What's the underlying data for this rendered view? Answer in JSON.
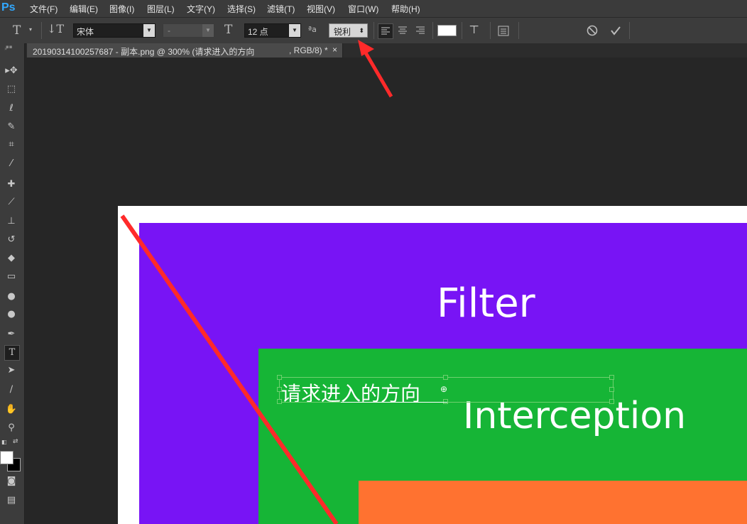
{
  "app": {
    "logo": "Ps"
  },
  "menu": [
    {
      "label": "文件(F)"
    },
    {
      "label": "编辑(E)"
    },
    {
      "label": "图像(I)"
    },
    {
      "label": "图层(L)"
    },
    {
      "label": "文字(Y)"
    },
    {
      "label": "选择(S)"
    },
    {
      "label": "滤镜(T)"
    },
    {
      "label": "视图(V)"
    },
    {
      "label": "窗口(W)"
    },
    {
      "label": "帮助(H)"
    }
  ],
  "options": {
    "font_family": "宋体",
    "font_style": "-",
    "font_size": "12 点",
    "antialias": "锐利",
    "antialias_prefix": "ªa",
    "text_color": "#ffffff"
  },
  "document_tab": {
    "title": "20190314100257687 - 副本.png @ 300% (请求进入的方向",
    "mode": ", RGB/8) *",
    "close": "×"
  },
  "canvas": {
    "filter_text": "Filter",
    "interception_text": "Interception",
    "editing_text": "请求进入的方向",
    "colors": {
      "purple": "#7814f5",
      "green": "#16b536",
      "orange": "#ff7230",
      "annotation": "#ff2a2a"
    }
  },
  "tools": [
    {
      "icon": "move-icon"
    },
    {
      "icon": "marquee-icon"
    },
    {
      "icon": "lasso-icon"
    },
    {
      "icon": "quick-select-icon"
    },
    {
      "icon": "crop-icon"
    },
    {
      "icon": "eyedropper-icon"
    },
    {
      "icon": "healing-brush-icon"
    },
    {
      "icon": "brush-icon"
    },
    {
      "icon": "stamp-icon"
    },
    {
      "icon": "history-brush-icon"
    },
    {
      "icon": "eraser-icon"
    },
    {
      "icon": "gradient-icon"
    },
    {
      "icon": "blur-icon"
    },
    {
      "icon": "dodge-icon"
    },
    {
      "icon": "pen-icon"
    },
    {
      "icon": "type-icon"
    },
    {
      "icon": "path-select-icon"
    },
    {
      "icon": "line-icon"
    },
    {
      "icon": "hand-icon"
    },
    {
      "icon": "zoom-icon"
    }
  ]
}
